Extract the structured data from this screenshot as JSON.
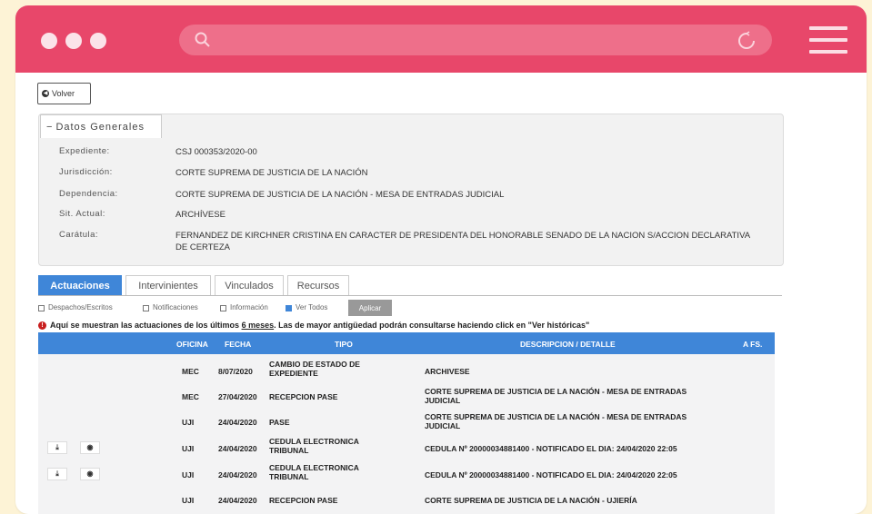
{
  "browser": {
    "accent": "#e8476a",
    "url_placeholder": ""
  },
  "back_button": {
    "label": "Volver"
  },
  "general": {
    "title": "Datos Generales",
    "fields": [
      {
        "label": "Expediente:",
        "value": "CSJ 000353/2020-00"
      },
      {
        "label": "Jurisdicción:",
        "value": "CORTE SUPREMA DE JUSTICIA DE LA NACIÓN"
      },
      {
        "label": "Dependencia:",
        "value": "CORTE SUPREMA DE JUSTICIA DE LA NACIÓN - MESA DE ENTRADAS JUDICIAL"
      },
      {
        "label": "Sit. Actual:",
        "value": "ARCHÍVESE"
      },
      {
        "label": "Carátula:",
        "value": "FERNANDEZ DE KIRCHNER CRISTINA EN CARACTER DE PRESIDENTA DEL HONORABLE SENADO DE LA NACION S/ACCION DECLARATIVA DE CERTEZA"
      }
    ]
  },
  "tabs": [
    "Actuaciones",
    "Intervinientes",
    "Vinculados",
    "Recursos"
  ],
  "filters": {
    "items": [
      "Despachos/Escritos",
      "Notificaciones",
      "Información",
      "Ver Todos"
    ],
    "apply": "Aplicar"
  },
  "notice": {
    "before": "Aquí se muestran las actuaciones de los últimos ",
    "link": "6 meses",
    "after": ". Las de mayor antigüedad podrán consultarse haciendo click en \"Ver históricas\""
  },
  "table": {
    "headers": {
      "oficina": "OFICINA",
      "fecha": "FECHA",
      "tipo": "TIPO",
      "descripcion": "DESCRIPCION / DETALLE",
      "afs": "A FS."
    },
    "rows": [
      {
        "oficina": "MEC",
        "fecha": "8/07/2020",
        "tipo": "CAMBIO DE ESTADO DE EXPEDIENTE",
        "descripcion": "ARCHIVESE"
      },
      {
        "oficina": "MEC",
        "fecha": "27/04/2020",
        "tipo": "RECEPCION PASE",
        "descripcion": "CORTE SUPREMA DE JUSTICIA DE LA NACIÓN - MESA DE ENTRADAS JUDICIAL"
      },
      {
        "oficina": "UJI",
        "fecha": "24/04/2020",
        "tipo": "PASE",
        "descripcion": "CORTE SUPREMA DE JUSTICIA DE LA NACIÓN - MESA DE ENTRADAS JUDICIAL"
      },
      {
        "oficina": "UJI",
        "fecha": "24/04/2020",
        "tipo": "CEDULA ELECTRONICA TRIBUNAL",
        "descripcion": "CEDULA Nº 20000034881400 - NOTIFICADO EL DIA: 24/04/2020 22:05"
      },
      {
        "oficina": "UJI",
        "fecha": "24/04/2020",
        "tipo": "CEDULA ELECTRONICA TRIBUNAL",
        "descripcion": "CEDULA Nº 20000034881400 - NOTIFICADO EL DIA: 24/04/2020 22:05"
      },
      {
        "oficina": "UJI",
        "fecha": "24/04/2020",
        "tipo": "RECEPCION PASE",
        "descripcion": "CORTE SUPREMA DE JUSTICIA DE LA NACIÓN - UJIERÍA"
      }
    ]
  }
}
